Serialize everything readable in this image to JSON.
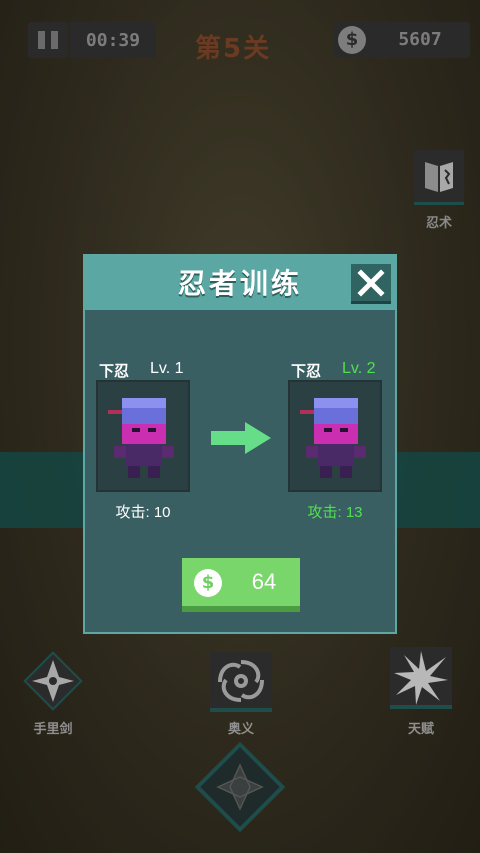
{
  "hud": {
    "timer": "00:39",
    "level_title": "第5关",
    "coins": "5607",
    "coin_symbol": "$"
  },
  "side_button": {
    "label": "忍术"
  },
  "modal": {
    "title": "忍者训练",
    "current": {
      "rank": "下忍",
      "level": "Lv. 1",
      "attack": "攻击: 10"
    },
    "next": {
      "rank": "下忍",
      "level": "Lv. 2",
      "attack": "攻击: 13"
    },
    "cost_symbol": "$",
    "cost": "64"
  },
  "bottom_menu": {
    "items": [
      {
        "label": "手里剑",
        "icon": "shuriken-icon"
      },
      {
        "label": "奥义",
        "icon": "vortex-icon"
      },
      {
        "label": "天赋",
        "icon": "star-burst-icon"
      }
    ]
  },
  "colors": {
    "modal_header": "#5aa7a3",
    "modal_body": "#3a5f63",
    "upgrade_green": "#4fe04f",
    "button_green": "#79d66a"
  }
}
